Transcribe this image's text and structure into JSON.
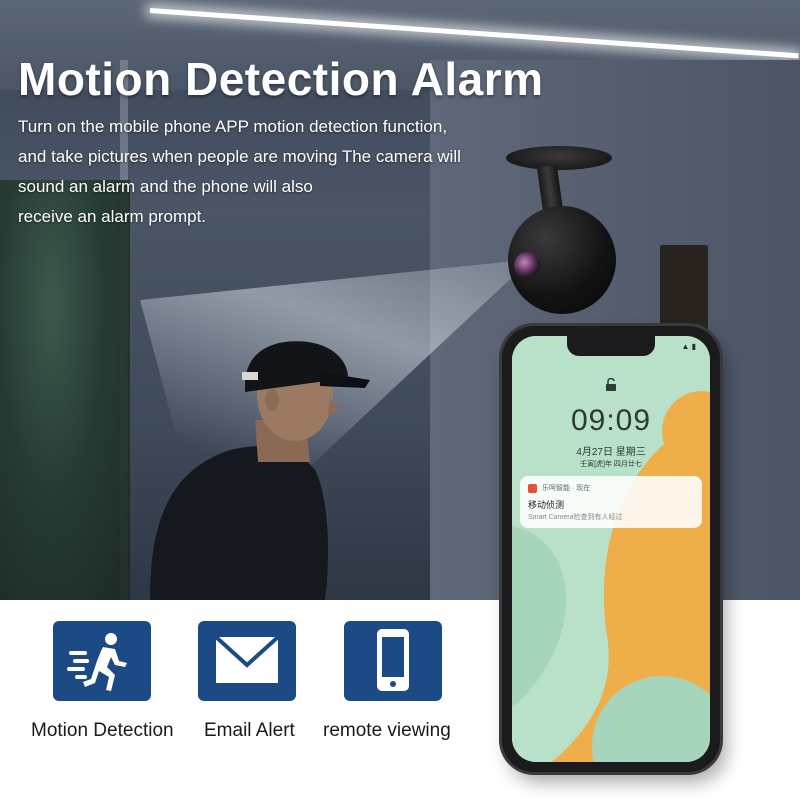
{
  "headline": {
    "title": "Motion Detection Alarm",
    "description": [
      "Turn on the mobile phone APP motion detection function,",
      "and take pictures when people are moving The camera will",
      "sound an alarm and the phone will also",
      "receive an alarm prompt."
    ]
  },
  "phone": {
    "time": "09:09",
    "date": "4月27日  星期三",
    "lunar": "壬寅[虎]年 四月廿七",
    "notification": {
      "app": "乐呵智能 · 现在",
      "title": "移动侦测",
      "body": "Smart Camera检查到有人经过"
    }
  },
  "features": [
    {
      "label": "Motion Detection",
      "icon": "running-person-icon"
    },
    {
      "label": "Email Alert",
      "icon": "envelope-icon"
    },
    {
      "label": "remote viewing",
      "icon": "smartphone-icon"
    }
  ],
  "colors": {
    "feature_bg": "#1c4a85",
    "screen_green": "#b9e0c9",
    "screen_orange": "#eeae4a"
  }
}
